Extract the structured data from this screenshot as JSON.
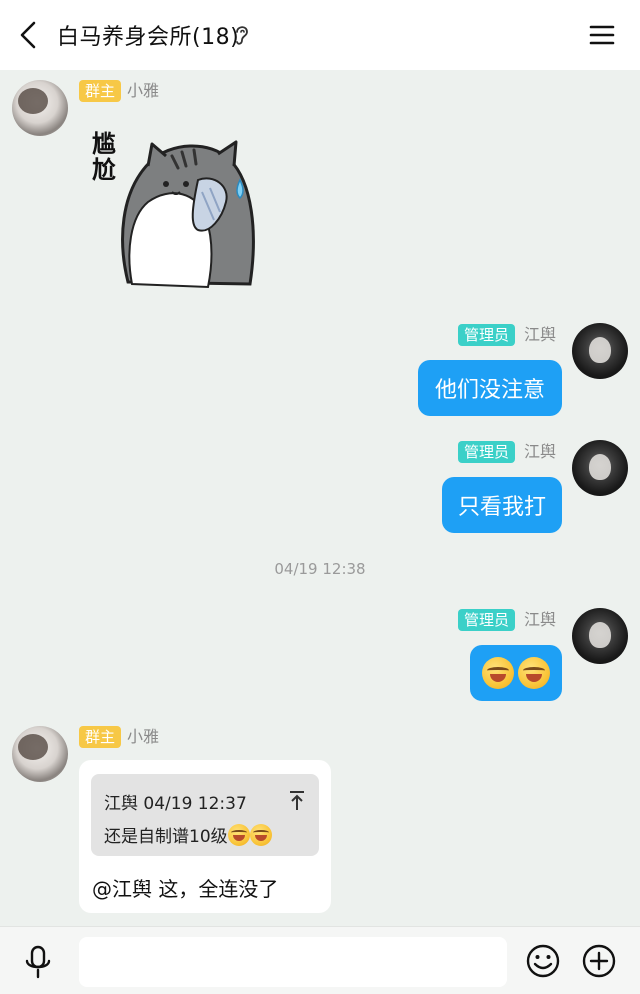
{
  "header": {
    "title": "白马养身会所(18)",
    "back_icon": "chevron-left-icon",
    "ear_icon": "ear-icon",
    "menu_icon": "hamburger-menu-icon"
  },
  "messages": [
    {
      "sender": "小雅",
      "role": "群主",
      "side": "left",
      "type": "sticker",
      "sticker_text": "尴尬"
    },
    {
      "sender": "江舆",
      "role": "管理员",
      "side": "right",
      "type": "text",
      "text": "他们没注意"
    },
    {
      "sender": "江舆",
      "role": "管理员",
      "side": "right",
      "type": "text",
      "text": "只看我打"
    },
    {
      "type": "timestamp",
      "text": "04/19 12:38"
    },
    {
      "sender": "江舆",
      "role": "管理员",
      "side": "right",
      "type": "emoji",
      "emoji": [
        "crying-laughing-emoji",
        "crying-laughing-emoji"
      ]
    },
    {
      "sender": "小雅",
      "role": "群主",
      "side": "left",
      "type": "reply",
      "quote": {
        "author_time": "江舆 04/19 12:37",
        "text": "还是自制谱10级"
      },
      "text": "@江舆 这，全连没了"
    }
  ],
  "input_bar": {
    "mic_icon": "microphone-icon",
    "emoji_icon": "smiley-icon",
    "plus_icon": "plus-circle-icon",
    "text_value": ""
  },
  "colors": {
    "background": "#edf1ee",
    "outgoing_bubble": "#1ea0f5",
    "owner_badge": "#f7c846",
    "admin_badge": "#3bd0c8"
  }
}
